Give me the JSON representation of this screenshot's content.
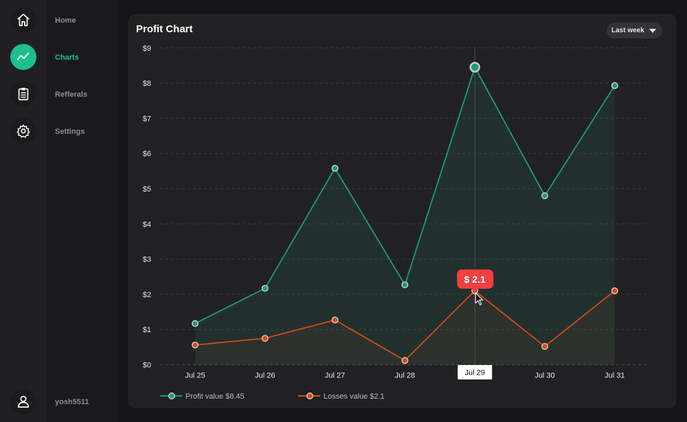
{
  "sidebar": {
    "items": [
      {
        "label": "Home",
        "icon": "home-icon"
      },
      {
        "label": "Charts",
        "icon": "chart-line-icon",
        "active": true
      },
      {
        "label": "Refferals",
        "icon": "clipboard-icon"
      },
      {
        "label": "Settings",
        "icon": "gear-icon"
      }
    ],
    "user": {
      "name": "yosh5511",
      "icon": "user-icon"
    }
  },
  "colors": {
    "accent": "#1dbf8f",
    "profit": "#1f9a7c",
    "losses": "#d84a17",
    "tooltip": "#ef3f41"
  },
  "card": {
    "title": "Profit Chart",
    "range": "Last week"
  },
  "tooltip": {
    "text": "$ 2.1",
    "hovered_index": 4,
    "hovered_x_label": "Jul 29"
  },
  "chart_data": {
    "type": "line",
    "categories": [
      "Jul 25",
      "Jul 26",
      "Jul 27",
      "Jul 28",
      "Jul 29",
      "Jul 30",
      "Jul 31"
    ],
    "y_ticks": [
      "$0",
      "$1",
      "$2",
      "$3",
      "$4",
      "$5",
      "$6",
      "$7",
      "$8",
      "$9"
    ],
    "ylim": [
      0,
      9
    ],
    "grid": true,
    "legend_position": "bottom-left",
    "series": [
      {
        "name": "Profit",
        "legend_label": "Profit  value $8.45",
        "values": [
          1.17,
          2.17,
          5.58,
          2.27,
          8.45,
          4.8,
          7.93
        ]
      },
      {
        "name": "Losses",
        "legend_label": "Losses  value $2.1",
        "values": [
          0.56,
          0.75,
          1.27,
          0.12,
          2.1,
          0.52,
          2.1
        ]
      }
    ]
  }
}
